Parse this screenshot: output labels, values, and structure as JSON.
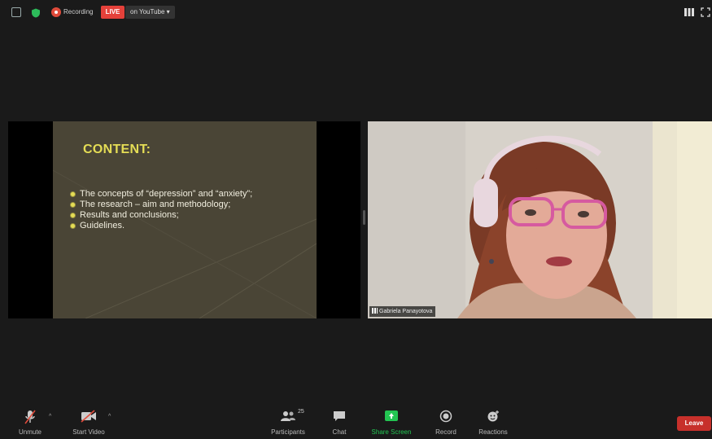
{
  "topbar": {
    "recording_label": "Recording",
    "live_label": "LIVE",
    "youtube_label": "on YouTube ▾"
  },
  "slide": {
    "title": "CONTENT:",
    "bullets": [
      "The concepts of “depression” and “anxiety”;",
      "The research – aim and methodology;",
      "Results and conclusions;",
      "Guidelines."
    ]
  },
  "participant": {
    "name": "Gabriela Panayotova"
  },
  "toolbar": {
    "unmute": "Unmute",
    "start_video": "Start Video",
    "participants": "Participants",
    "participants_count": "25",
    "chat": "Chat",
    "share_screen": "Share Screen",
    "record": "Record",
    "reactions": "Reactions",
    "leave": "Leave"
  },
  "colors": {
    "live": "#e5413a",
    "leave": "#c7302b",
    "share_screen": "#23c552",
    "slide_bg": "#4a4536",
    "slide_title": "#e5dd55"
  },
  "icons": [
    "info-icon",
    "shield-icon",
    "record-icon",
    "grid-view-icon",
    "fullscreen-icon",
    "mic-muted-icon",
    "video-off-icon",
    "participants-icon",
    "chat-icon",
    "share-screen-icon",
    "record-icon",
    "reactions-icon"
  ]
}
